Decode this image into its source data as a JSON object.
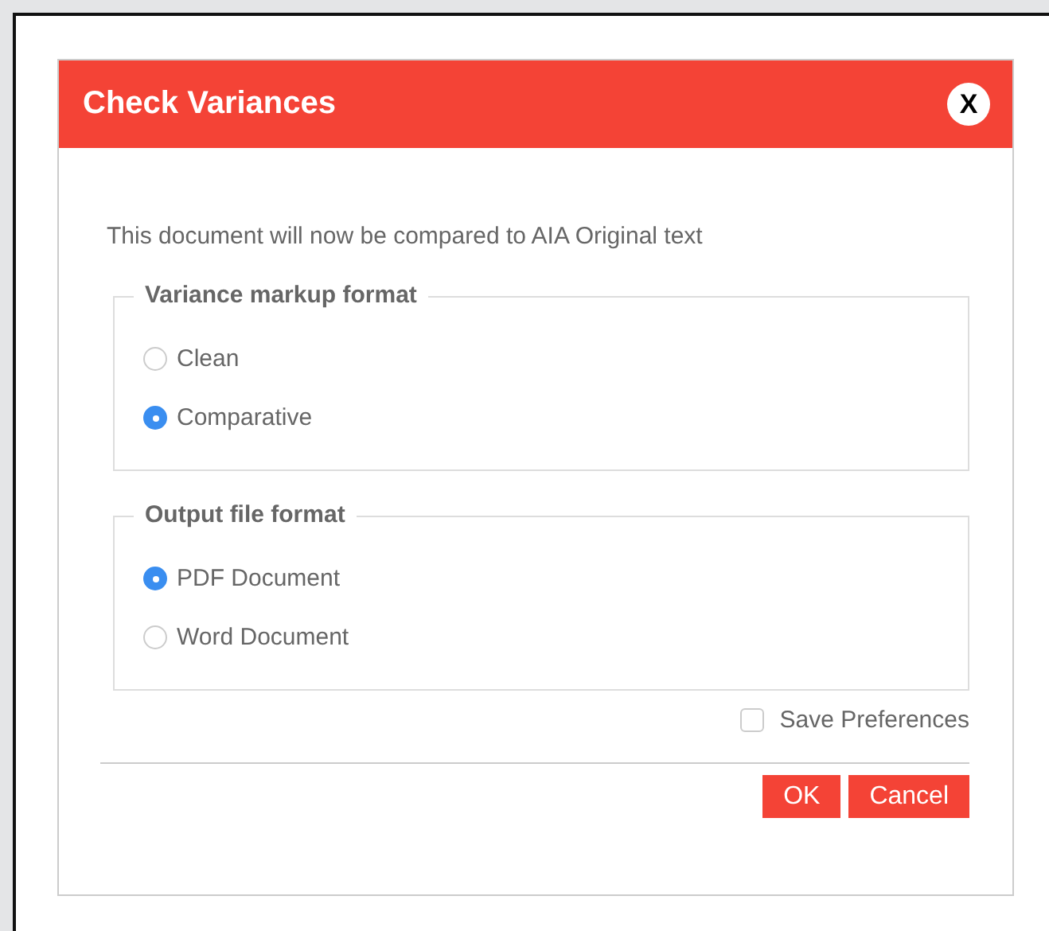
{
  "dialog": {
    "title": "Check Variances",
    "close_label": "X",
    "message": "This document will now be compared to AIA Original text",
    "groups": [
      {
        "legend": "Variance markup format",
        "options": [
          {
            "label": "Clean",
            "selected": false
          },
          {
            "label": "Comparative",
            "selected": true
          }
        ]
      },
      {
        "legend": "Output file format",
        "options": [
          {
            "label": "PDF Document",
            "selected": true
          },
          {
            "label": "Word Document",
            "selected": false
          }
        ]
      }
    ],
    "save_preferences": {
      "label": "Save Preferences",
      "checked": false
    },
    "buttons": [
      "OK",
      "Cancel"
    ]
  }
}
